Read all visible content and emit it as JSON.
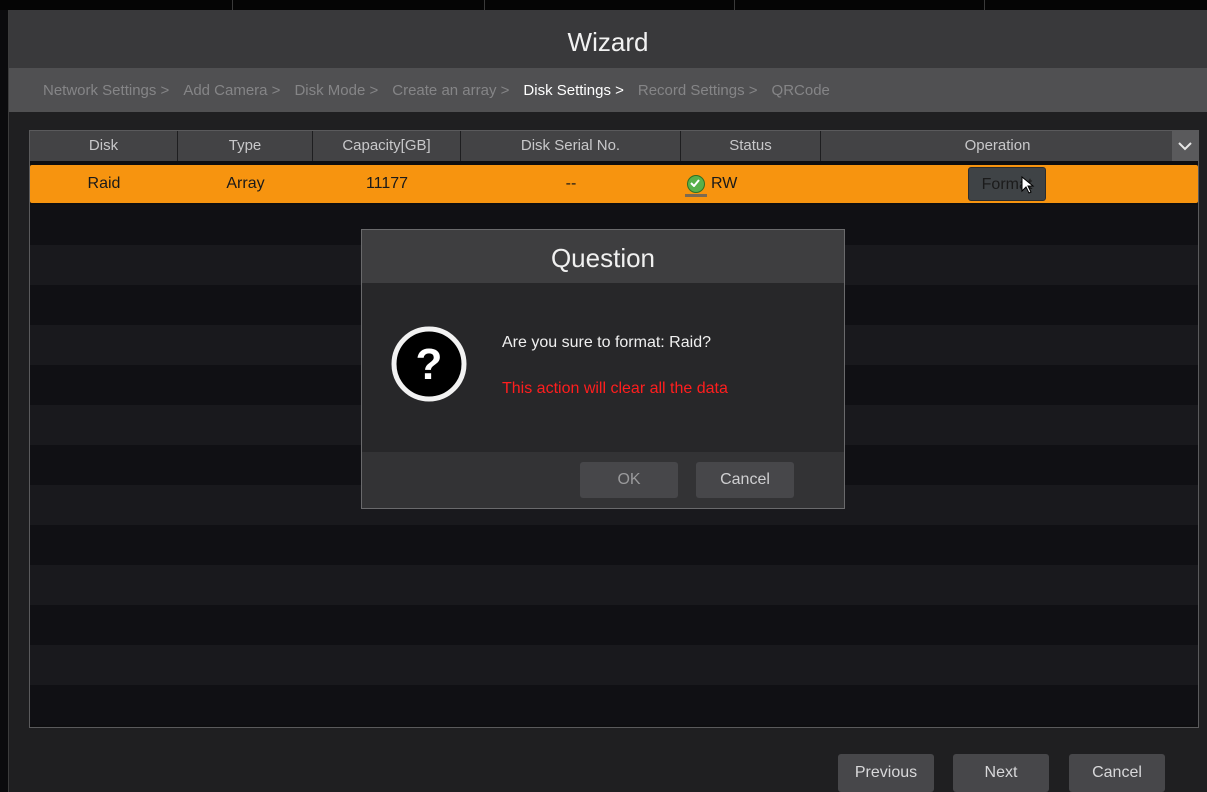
{
  "window": {
    "title": "Wizard"
  },
  "steps": [
    {
      "label": "Network Settings >",
      "active": false
    },
    {
      "label": "Add Camera >",
      "active": false
    },
    {
      "label": "Disk Mode >",
      "active": false
    },
    {
      "label": "Create an array >",
      "active": false
    },
    {
      "label": "Disk Settings >",
      "active": true
    },
    {
      "label": "Record Settings >",
      "active": false
    },
    {
      "label": "QRCode",
      "active": false
    }
  ],
  "table": {
    "columns": [
      "Disk",
      "Type",
      "Capacity[GB]",
      "Disk Serial No.",
      "Status",
      "Operation"
    ],
    "rows": [
      {
        "disk": "Raid",
        "type": "Array",
        "capacity": "11177",
        "serial": "--",
        "status": "RW",
        "operation": "Format"
      }
    ]
  },
  "dialog": {
    "title": "Question",
    "message": "Are you sure to format: Raid?",
    "warning": "This action will clear all the data",
    "ok_label": "OK",
    "cancel_label": "Cancel"
  },
  "footer": {
    "previous_label": "Previous",
    "next_label": "Next",
    "cancel_label": "Cancel"
  },
  "colors": {
    "selected_row": "#f7940f",
    "warning_text": "#ff1e1e",
    "status_ok": "#58b04a"
  }
}
